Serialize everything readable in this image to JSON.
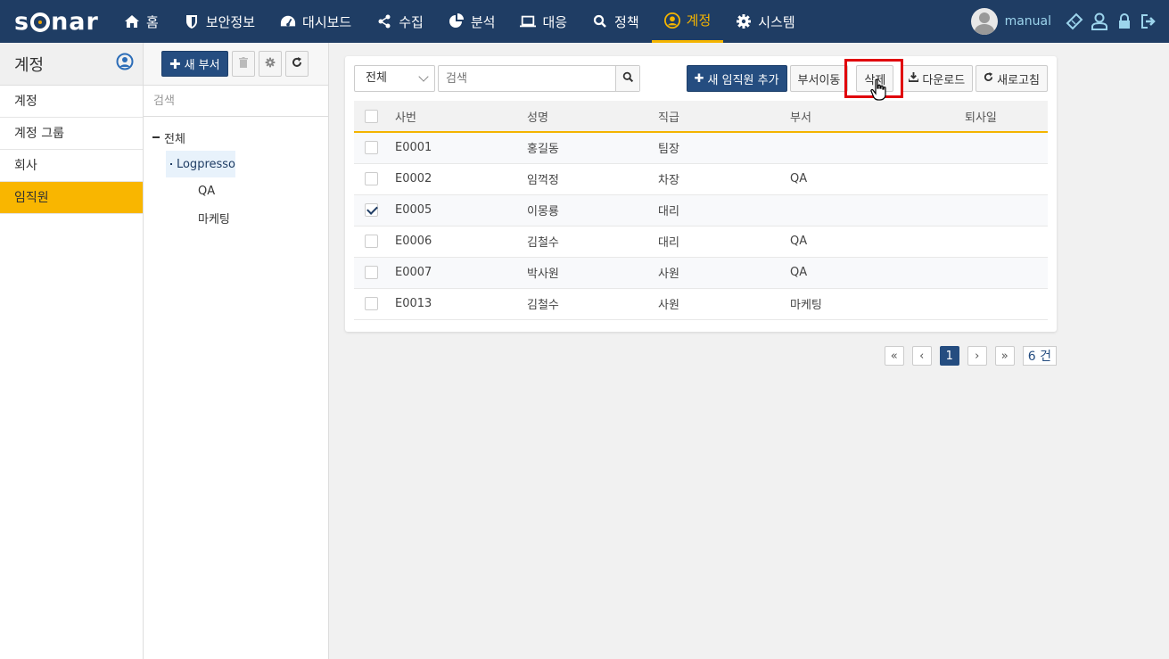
{
  "app": {
    "logo": "sonar"
  },
  "nav": {
    "items": [
      {
        "label": "홈",
        "icon": "home-icon"
      },
      {
        "label": "보안정보",
        "icon": "shield-icon"
      },
      {
        "label": "대시보드",
        "icon": "dashboard-icon"
      },
      {
        "label": "수집",
        "icon": "share-icon"
      },
      {
        "label": "분석",
        "icon": "pie-chart-icon"
      },
      {
        "label": "대응",
        "icon": "laptop-icon"
      },
      {
        "label": "정책",
        "icon": "search-icon"
      },
      {
        "label": "계정",
        "icon": "user-circle-icon",
        "active": true
      },
      {
        "label": "시스템",
        "icon": "gear-icon"
      }
    ],
    "username": "manual",
    "accent": "#f4b400",
    "bg": "#1f3d64"
  },
  "sidebar": {
    "title": "계정",
    "items": [
      {
        "label": "계정"
      },
      {
        "label": "계정 그룹"
      },
      {
        "label": "회사"
      },
      {
        "label": "임직원",
        "active": true
      }
    ]
  },
  "dept": {
    "new_button": "새 부서",
    "search_placeholder": "검색",
    "tree": {
      "root": "전체",
      "company": "Logpresso",
      "children": [
        "QA",
        "마케팅"
      ]
    }
  },
  "main": {
    "filter": "전체",
    "search_placeholder": "검색",
    "buttons": {
      "add": "새 임직원 추가",
      "move": "부서이동",
      "delete": "삭제",
      "download": "다운로드",
      "refresh": "새로고침"
    },
    "table": {
      "headers": [
        "사번",
        "성명",
        "직급",
        "부서",
        "퇴사일"
      ],
      "rows": [
        {
          "id": "E0001",
          "name": "홍길동",
          "rank": "팀장",
          "dept": "",
          "retire": "",
          "checked": false
        },
        {
          "id": "E0002",
          "name": "임꺽정",
          "rank": "차장",
          "dept": "QA",
          "retire": "",
          "checked": false
        },
        {
          "id": "E0005",
          "name": "이몽룡",
          "rank": "대리",
          "dept": "",
          "retire": "",
          "checked": true
        },
        {
          "id": "E0006",
          "name": "김철수",
          "rank": "대리",
          "dept": "QA",
          "retire": "",
          "checked": false
        },
        {
          "id": "E0007",
          "name": "박사원",
          "rank": "사원",
          "dept": "QA",
          "retire": "",
          "checked": false
        },
        {
          "id": "E0013",
          "name": "김철수",
          "rank": "사원",
          "dept": "마케팅",
          "retire": "",
          "checked": false
        }
      ]
    },
    "pagination": {
      "first": "«",
      "prev": "‹",
      "current": "1",
      "next": "›",
      "last": "»",
      "count": "6 건"
    }
  }
}
